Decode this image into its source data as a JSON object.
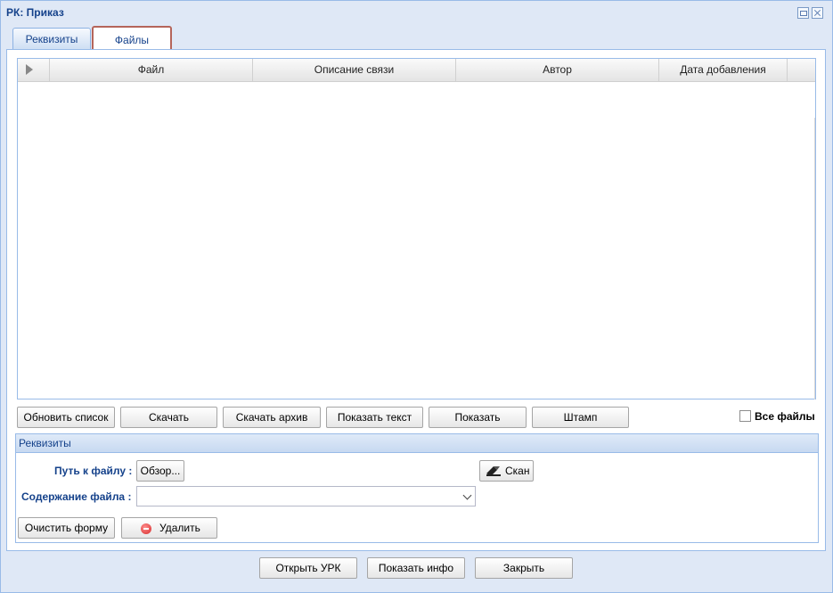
{
  "window": {
    "title": "РК: Приказ"
  },
  "tabs": [
    {
      "label": "Реквизиты"
    },
    {
      "label": "Файлы"
    }
  ],
  "grid": {
    "columns": [
      "Файл",
      "Описание связи",
      "Автор",
      "Дата добавления"
    ]
  },
  "toolbar": {
    "refresh": "Обновить список",
    "download": "Скачать",
    "download_archive": "Скачать архив",
    "show_text": "Показать текст",
    "show": "Показать",
    "stamp": "Штамп",
    "all_files": "Все файлы"
  },
  "details": {
    "title": "Реквизиты",
    "file_path_label": "Путь к файлу :",
    "browse": "Обзор...",
    "scan": "Скан",
    "content_label": "Содержание файла :",
    "content_value": "",
    "clear": "Очистить форму",
    "delete": "Удалить"
  },
  "footer": {
    "open_urk": "Открыть УРК",
    "show_info": "Показать инфо",
    "close": "Закрыть"
  }
}
